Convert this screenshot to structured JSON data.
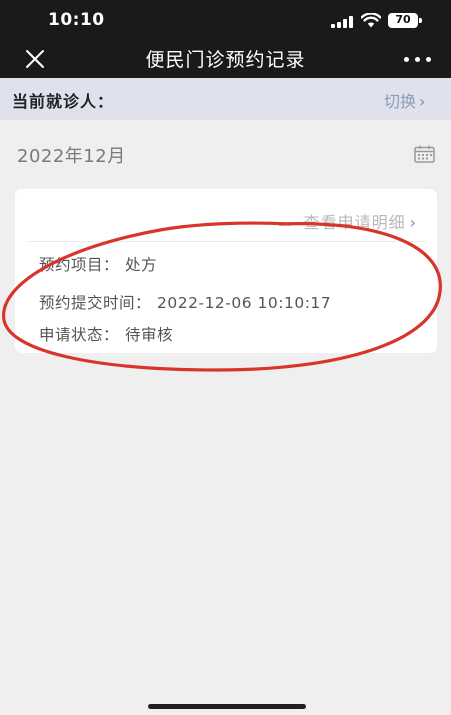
{
  "status_bar": {
    "time": "10:10",
    "battery": "70"
  },
  "nav": {
    "title": "便民门诊预约记录"
  },
  "patient": {
    "label": "当前就诊人：",
    "switch_label": "切换",
    "switch_chevron": "›"
  },
  "month": {
    "label": "2022年12月"
  },
  "record": {
    "detail_link": "查看申请明细",
    "detail_chevron": "›",
    "fields": [
      {
        "label": "预约项目",
        "sep": "：",
        "value": "处方"
      },
      {
        "label": "预约提交时间",
        "sep": "：",
        "value": "2022-12-06 10:10:17"
      },
      {
        "label": "申请状态",
        "sep": "：",
        "value": "待审核"
      }
    ]
  },
  "colors": {
    "top_bar": "#1a1a1a",
    "patient_bar": "#dfe2ec",
    "background": "#efefef",
    "link_blue": "#6d8fc6",
    "annotation_red": "#d8352a"
  },
  "icons": {
    "close": "close-icon",
    "more": "more-icon",
    "calendar": "calendar-icon",
    "wifi": "wifi-icon",
    "signal": "signal-icon",
    "battery": "battery-icon"
  }
}
